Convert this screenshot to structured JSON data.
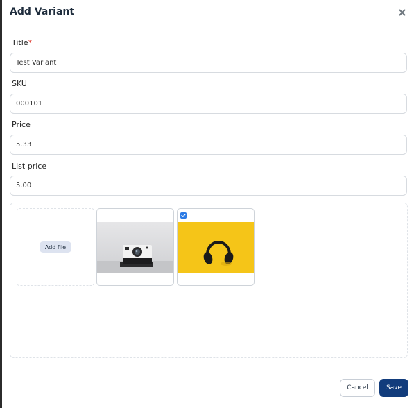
{
  "modal": {
    "title": "Add Variant",
    "close_icon": "close-icon"
  },
  "fields": {
    "title": {
      "label": "Title",
      "required_mark": "*",
      "value": "Test Variant"
    },
    "sku": {
      "label": "SKU",
      "value": "000101"
    },
    "price": {
      "label": "Price",
      "value": "5.33"
    },
    "list_price": {
      "label": "List price",
      "value": "5.00"
    }
  },
  "media": {
    "add_file_label": "Add file",
    "images": [
      {
        "name": "camera-image",
        "checked": false
      },
      {
        "name": "headphones-image",
        "checked": true
      }
    ]
  },
  "footer": {
    "cancel_label": "Cancel",
    "save_label": "Save"
  },
  "colors": {
    "primary": "#123c7c",
    "required": "#e0463b",
    "checkbox": "#2c7be5",
    "headphones_bg": "#f5c518"
  }
}
